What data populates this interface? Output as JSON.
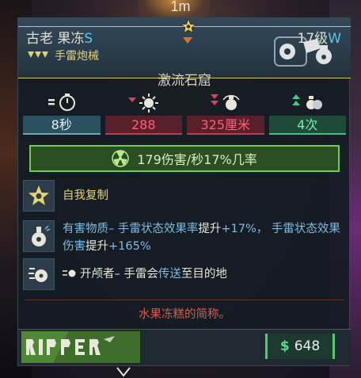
{
  "hud": {
    "distance": "1m"
  },
  "item": {
    "name": "古老 果冻",
    "rank": "S",
    "level": "17级",
    "level_suffix": "W",
    "category": "手雷炮械",
    "subtitle": "激流石窟",
    "rarity_color": "#d6c060"
  },
  "stats": [
    {
      "icon": "timer-icon",
      "indicator": "=",
      "value": "8秒",
      "tone": "neutral"
    },
    {
      "icon": "damage-icon",
      "indicator": "down",
      "value": "288",
      "tone": "worse"
    },
    {
      "icon": "radius-icon",
      "indicator": "double-down",
      "value": "325厘米",
      "tone": "worse"
    },
    {
      "icon": "grenade-count-icon",
      "indicator": "double-up",
      "value": "4次",
      "tone": "better"
    }
  ],
  "element_effect": {
    "icon": "radiation-icon",
    "text": "179伤害/秒17%几率",
    "color": "#6fcf4a"
  },
  "perks": [
    {
      "icon": "star-badge-icon",
      "segments": [
        {
          "t": "自我复制",
          "c": "hi"
        }
      ]
    },
    {
      "icon": "hazard-flask-icon",
      "segments": [
        {
          "t": "有害物质– 手雷状态效果率",
          "c": "n"
        },
        {
          "t": "提升",
          "c": "w"
        },
        {
          "t": "+17%， 手雷状态效果伤害",
          "c": "n"
        },
        {
          "t": "提升",
          "c": "w"
        },
        {
          "t": "+165%",
          "c": "n"
        }
      ]
    },
    {
      "icon": "grenade-teleport-icon",
      "segments": [
        {
          "t": "开颅者– 手雷会",
          "c": "w"
        },
        {
          "t": "传送",
          "c": "n"
        },
        {
          "t": "至目的地",
          "c": "w"
        }
      ]
    }
  ],
  "flavor_text": "水果冻糕的简称。",
  "manufacturer": {
    "logo": "ripper-logo",
    "name": "RIPPER"
  },
  "price": {
    "currency_symbol": "$",
    "value": "648"
  },
  "colors": {
    "accent_gold": "#d6c060",
    "rank_blue": "#57c8f0",
    "stat_worse": "#ff5f78",
    "stat_better": "#78f0b0",
    "flavor_red": "#e05a48",
    "price_green": "#57e08a"
  }
}
